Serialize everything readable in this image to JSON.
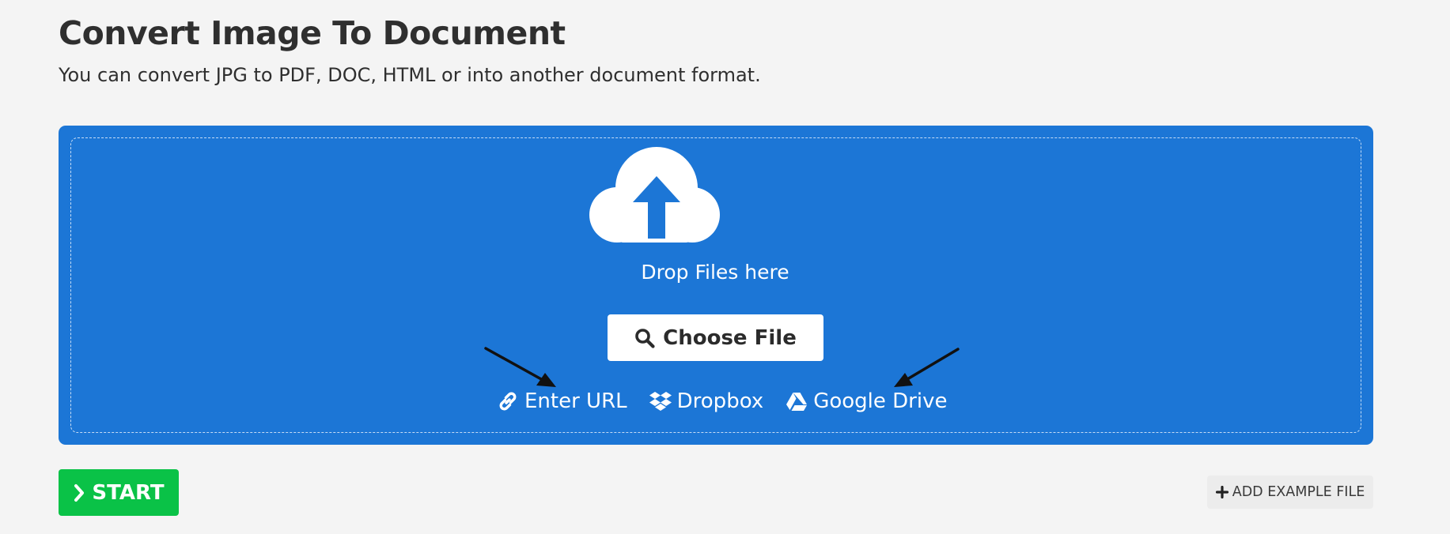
{
  "page": {
    "title": "Convert Image To Document",
    "subtitle": "You can convert JPG to PDF, DOC, HTML or into another document format."
  },
  "upload": {
    "drop_text": "Drop Files here",
    "choose_file_label": "Choose File",
    "sources": [
      {
        "label": "Enter URL",
        "icon": "link-icon"
      },
      {
        "label": "Dropbox",
        "icon": "dropbox-icon"
      },
      {
        "label": "Google Drive",
        "icon": "google-drive-icon"
      }
    ]
  },
  "actions": {
    "start_label": "START",
    "add_example_label": "ADD EXAMPLE FILE"
  },
  "colors": {
    "upload_background": "#1c76d6",
    "start_button": "#0ac247",
    "page_background": "#f4f4f4"
  }
}
